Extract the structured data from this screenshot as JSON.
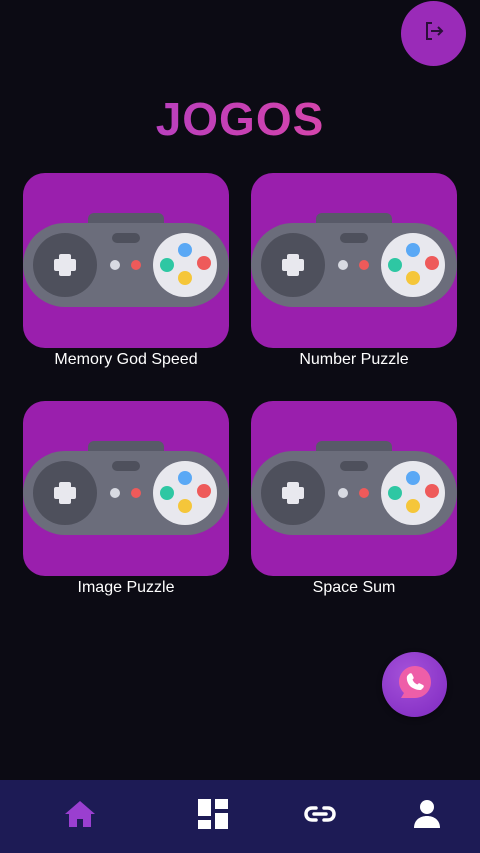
{
  "header": {
    "title": "JOGOS",
    "logout_icon": "logout-icon"
  },
  "games": [
    {
      "name": "Memory God Speed",
      "icon": "gamepad-icon"
    },
    {
      "name": "Number Puzzle",
      "icon": "gamepad-icon"
    },
    {
      "name": "Image Puzzle",
      "icon": "gamepad-icon"
    },
    {
      "name": "Space Sum",
      "icon": "gamepad-icon"
    }
  ],
  "fab": {
    "icon": "chat-phone-icon"
  },
  "bottom_nav": {
    "items": [
      {
        "icon": "home-icon",
        "active": true
      },
      {
        "icon": "dashboard-icon",
        "active": false
      },
      {
        "icon": "link-icon",
        "active": false
      },
      {
        "icon": "person-icon",
        "active": false
      }
    ]
  },
  "colors": {
    "background": "#0c0b14",
    "accent": "#9a2bb8",
    "card": "#9a1fad",
    "nav_bar": "#1d1b55",
    "nav_active": "#9a3fd0",
    "title_gradient_start": "#a33fd1",
    "title_gradient_end": "#ef4f9d"
  }
}
